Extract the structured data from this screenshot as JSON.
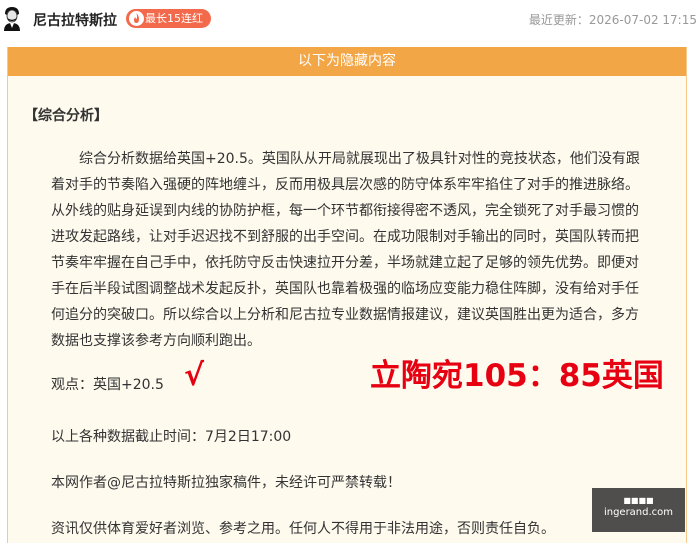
{
  "header": {
    "author": "尼古拉特斯拉",
    "streak_badge": "最长15连红",
    "updated": "最近更新：2026-07-02 17:15"
  },
  "hidden": {
    "bar_label": "以下为隐藏内容",
    "section_title": "【综合分析】",
    "paragraph": "综合分析数据给英国+20.5。英国队从开局就展现出了极具针对性的竞技状态，他们没有跟着对手的节奏陷入强硬的阵地缠斗，反而用极具层次感的防守体系牢牢掐住了对手的推进脉络。从外线的贴身延误到内线的协防护框，每一个环节都衔接得密不透风，完全锁死了对手最习惯的进攻发起路线，让对手迟迟找不到舒服的出手空间。在成功限制对手输出的同时，英国队转而把节奏牢牢握在自己手中，依托防守反击快速拉开分差，半场就建立起了足够的领先优势。即便对手在后半段试图调整战术发起反扑，英国队也靠着极强的临场应变能力稳住阵脚，没有给对手任何追分的突破口。所以综合以上分析和尼古拉专业数据情报建议，建议英国胜出更为适合，多方数据也支撑该参考方向顺利跑出。",
    "opinion": "观点：英国+20.5",
    "check_mark": "√",
    "score": "立陶宛105：85英国",
    "deadline": "以上各种数据截止时间：7月2日17:00",
    "copyright": "本网作者@尼古拉特斯拉独家稿件，未经许可严禁转载！",
    "disclaimer": "资讯仅供体育爱好者浏览、参考之用。任何人不得用于非法用途，否则责任自负。"
  },
  "watermark": {
    "top": "■■■■",
    "bottom": "ingerand.com"
  },
  "colors": {
    "bar": "#f2a646",
    "box_bg": "#fefaee",
    "badge": "#f26a4b",
    "accent_red": "#e60012"
  }
}
